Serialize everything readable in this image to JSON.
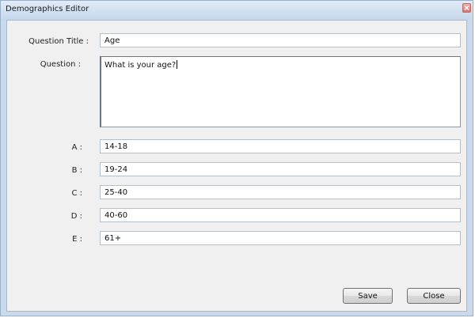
{
  "window": {
    "title": "Demographics Editor"
  },
  "form": {
    "question_title_label": "Question Title :",
    "question_title_value": "Age",
    "question_label": "Question :",
    "question_value": "What is your age?",
    "answers": [
      {
        "label": "A :",
        "value": "14-18"
      },
      {
        "label": "B :",
        "value": "19-24"
      },
      {
        "label": "C :",
        "value": "25-40"
      },
      {
        "label": "D :",
        "value": "40-60"
      },
      {
        "label": "E :",
        "value": "61+"
      }
    ]
  },
  "buttons": {
    "save_label": "Save",
    "close_label": "Close"
  },
  "colors": {
    "titlebar": "#d3e1f1",
    "client_background": "#f0f0f0",
    "close_button": "#d07a70"
  },
  "icons": {
    "close": "close-icon"
  }
}
